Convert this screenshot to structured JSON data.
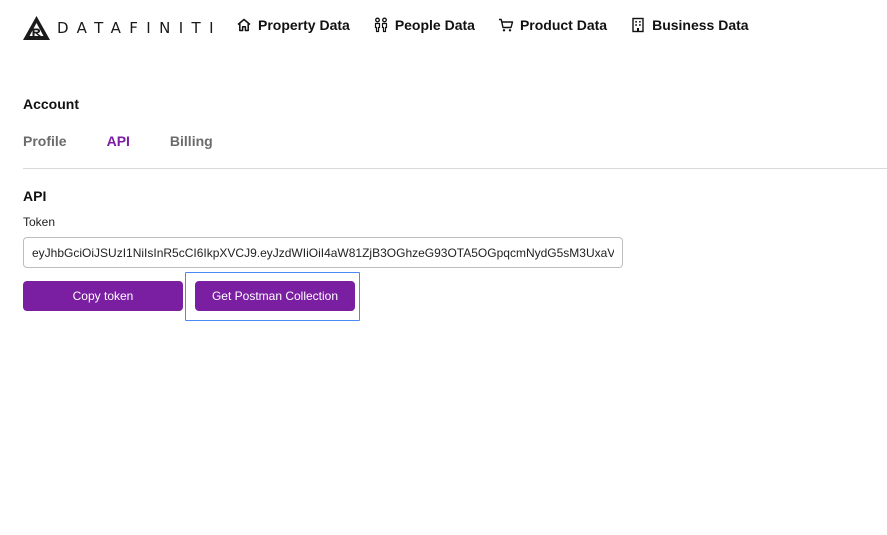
{
  "brand": {
    "name": "DATAFINITI"
  },
  "nav": {
    "items": [
      {
        "label": "Property Data",
        "icon": "home-icon"
      },
      {
        "label": "People Data",
        "icon": "people-icon"
      },
      {
        "label": "Product Data",
        "icon": "cart-icon"
      },
      {
        "label": "Business Data",
        "icon": "building-icon"
      }
    ]
  },
  "account": {
    "title": "Account",
    "tabs": [
      {
        "label": "Profile",
        "active": false
      },
      {
        "label": "API",
        "active": true
      },
      {
        "label": "Billing",
        "active": false
      }
    ]
  },
  "api": {
    "title": "API",
    "token_label": "Token",
    "token_value": "eyJhbGciOiJSUzI1NiIsInR5cCI6IkpXVCJ9.eyJzdWIiOiI4aW81ZjB3OGhzeG93OTA5OGpqcmNydG5sM3UxaV",
    "copy_button": "Copy token",
    "postman_button": "Get Postman Collection"
  },
  "colors": {
    "accent": "#7b1fa2",
    "focus": "#4a8af4",
    "divider": "#d9d9d9"
  }
}
